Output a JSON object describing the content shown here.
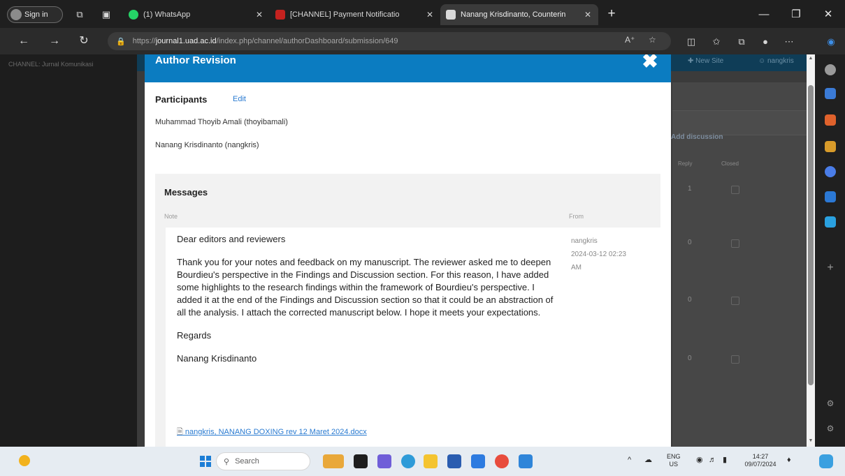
{
  "browser": {
    "signin_label": "Sign in",
    "tabs": [
      {
        "title": "(1) WhatsApp",
        "favicon_color": "#25d366"
      },
      {
        "title": "[CHANNEL] Payment Notificatio",
        "favicon_color": "#c5221f"
      },
      {
        "title": "Nanang Krisdinanto, Counterin",
        "favicon_color": "#d9d9d9"
      }
    ],
    "url_prefix": "https://",
    "url_domain": "journal1.uad.ac.id",
    "url_path": "/index.php/channel/authorDashboard/submission/649"
  },
  "background_page": {
    "brand": "CHANNEL: Jurnal Komunikasi",
    "new_site": "✚ New Site",
    "user": "☺ nangkris",
    "add_discussion": "Add discussion",
    "col_reply": "Reply",
    "col_closed": "Closed",
    "row_values": [
      "1",
      "0",
      "0",
      "0"
    ]
  },
  "modal": {
    "title": "Author Revision",
    "participants_heading": "Participants",
    "edit_label": "Edit",
    "participants": [
      "Muhammad Thoyib Amali (thoyibamali)",
      "Nanang Krisdinanto (nangkris)"
    ],
    "messages_heading": "Messages",
    "col_note": "Note",
    "col_from": "From",
    "message": {
      "greeting": "Dear editors and reviewers",
      "body": "Thank you for your notes and feedback on my manuscript. The reviewer asked me to deepen Bourdieu's perspective in the Findings and Discussion section. For this reason, I have added some highlights to the research findings within the framework of Bourdieu's perspective. I added it at the end of the Findings and Discussion section so that it could be an abstraction of all the analysis. I attach the corrected manuscript below. I hope it meets your expectations.",
      "regards": "Regards",
      "signature": "Nanang Krisdinanto",
      "from_user": "nangkris",
      "from_date": "2024-03-12 02:23",
      "from_time": "AM",
      "attachment": "nangkris, NANANG DOXING rev 12 Maret 2024.docx"
    }
  },
  "taskbar": {
    "search_placeholder": "Search",
    "lang": "ENG",
    "region": "US",
    "time": "14:27",
    "date": "09/07/2024"
  },
  "colors": {
    "modal_header": "#0b7cc1",
    "link": "#2a7bd1"
  }
}
